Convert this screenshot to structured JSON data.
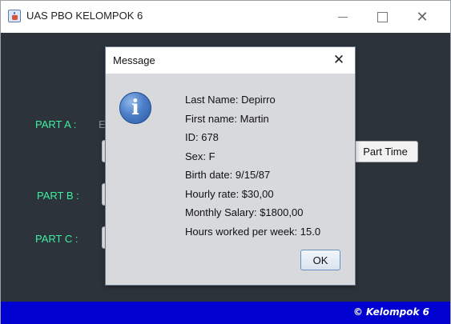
{
  "window": {
    "title": "UAS PBO KELOMPOK 6",
    "icon": "java-cup-icon",
    "controls": {
      "minimize": "—",
      "maximize": "☐",
      "close": "✕"
    }
  },
  "main": {
    "parts": [
      {
        "label": "PART A :"
      },
      {
        "label": "PART B :"
      },
      {
        "label": "PART C :"
      }
    ],
    "partA_stub_text": "E",
    "part_time_button": "Part Time"
  },
  "footer": {
    "text": "© Kelompok 6"
  },
  "colors": {
    "background": "#2d333b",
    "part_label": "#3cf0a0",
    "footer_bar": "#0000d0"
  },
  "dialog": {
    "title": "Message",
    "close": "✕",
    "icon": "info-icon",
    "icon_glyph": "i",
    "lines": [
      "Last Name: Depirro",
      "First name: Martin",
      "ID: 678",
      "Sex: F",
      "Birth date: 9/15/87",
      "Hourly rate: $30,00",
      "Monthly Salary: $1800,00",
      "Hours worked per week: 15.0"
    ],
    "ok_label": "OK"
  }
}
